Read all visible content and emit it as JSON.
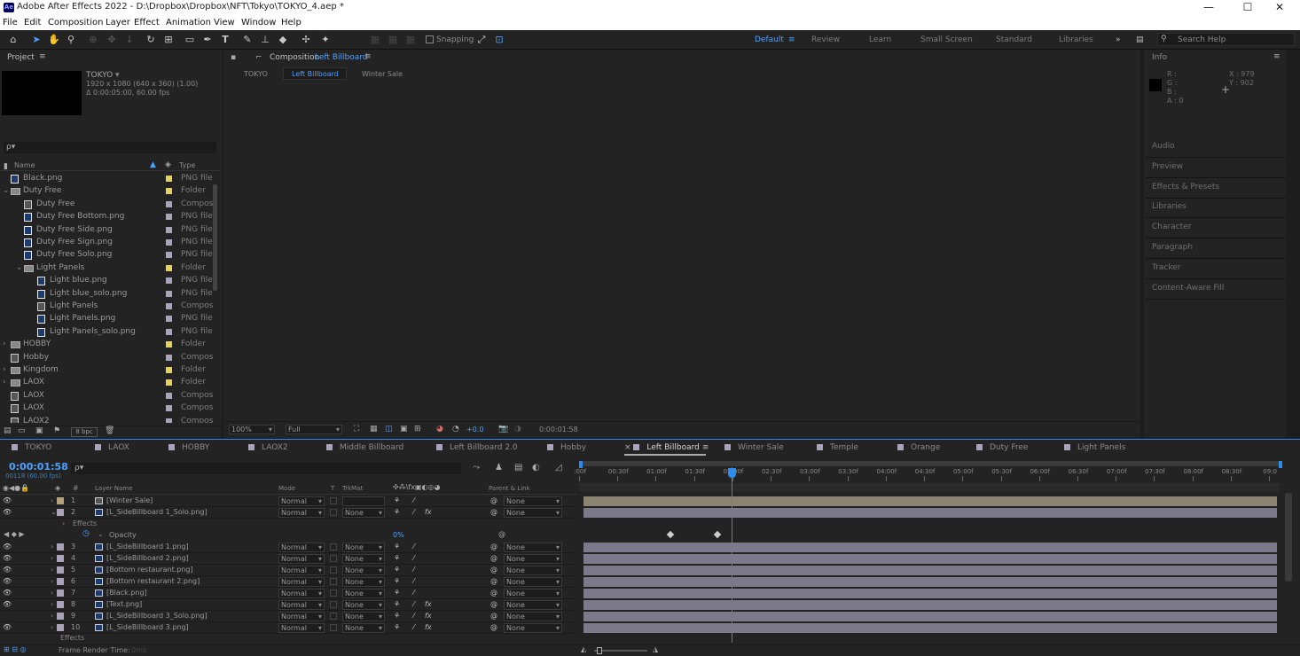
{
  "titlebar": {
    "app_icon": "Ae",
    "title": "Adobe After Effects 2022 - D:\\Dropbox\\Dropbox\\NFT\\Tokyo\\TOKYO_4.aep *",
    "minimize": "—",
    "maximize": "☐",
    "close": "✕"
  },
  "menu": [
    "File",
    "Edit",
    "Composition",
    "Layer",
    "Effect",
    "Animation",
    "View",
    "Window",
    "Help"
  ],
  "toolbar": {
    "snapping": "Snapping",
    "search_placeholder": "Search Help",
    "workspaces": [
      "Default",
      "Review",
      "Learn",
      "Small Screen",
      "Standard",
      "Libraries"
    ],
    "more": "»"
  },
  "project": {
    "title": "Project",
    "comp_name": "TOKYO",
    "comp_info1": "1920 x 1080  (640 x 360) (1.00)",
    "comp_info2": "Δ 0:00:05:00, 60.00 fps",
    "search_placeholder": "ρ▾",
    "col_name": "Name",
    "col_type": "Type",
    "bpc": "8 bpc",
    "items": [
      {
        "name": "Black.png",
        "type": "PNG file",
        "indent": 0,
        "label": "#e5d25c"
      },
      {
        "name": "Duty Free",
        "type": "Folder",
        "indent": 0,
        "label": "#e5d25c",
        "expanded": true
      },
      {
        "name": "Duty Free",
        "type": "Compos",
        "indent": 1,
        "label": "#a9a4b9"
      },
      {
        "name": "Duty Free Bottom.png",
        "type": "PNG file",
        "indent": 1,
        "label": "#a9a4b9"
      },
      {
        "name": "Duty Free Side.png",
        "type": "PNG file",
        "indent": 1,
        "label": "#a9a4b9"
      },
      {
        "name": "Duty Free Sign.png",
        "type": "PNG file",
        "indent": 1,
        "label": "#a9a4b9"
      },
      {
        "name": "Duty Free Solo.png",
        "type": "PNG file",
        "indent": 1,
        "label": "#a9a4b9"
      },
      {
        "name": "Light Panels",
        "type": "Folder",
        "indent": 1,
        "label": "#e5d25c",
        "expanded": true
      },
      {
        "name": "Light blue.png",
        "type": "PNG file",
        "indent": 2,
        "label": "#a9a4b9"
      },
      {
        "name": "Light blue_solo.png",
        "type": "PNG file",
        "indent": 2,
        "label": "#a9a4b9"
      },
      {
        "name": "Light Panels",
        "type": "Compos",
        "indent": 2,
        "label": "#a9a4b9"
      },
      {
        "name": "Light Panels.png",
        "type": "PNG file",
        "indent": 2,
        "label": "#a9a4b9"
      },
      {
        "name": "Light Panels_solo.png",
        "type": "PNG file",
        "indent": 2,
        "label": "#a9a4b9"
      },
      {
        "name": "HOBBY",
        "type": "Folder",
        "indent": 0,
        "label": "#e5d25c"
      },
      {
        "name": "Hobby",
        "type": "Compos",
        "indent": 0,
        "label": "#a9a4b9"
      },
      {
        "name": "Kingdom",
        "type": "Folder",
        "indent": 0,
        "label": "#e5d25c"
      },
      {
        "name": "LAOX",
        "type": "Folder",
        "indent": 0,
        "label": "#e5d25c"
      },
      {
        "name": "LAOX",
        "type": "Compos",
        "indent": 0,
        "label": "#a9a4b9"
      },
      {
        "name": "LAOX",
        "type": "Compos",
        "indent": 0,
        "label": "#a9a4b9"
      },
      {
        "name": "LAOX2",
        "type": "Compos",
        "indent": 0,
        "label": "#a9a4b9"
      }
    ]
  },
  "composition": {
    "panel_label": "Composition",
    "active_name": "Left Billboard",
    "breadcrumbs": [
      "TOKYO",
      "Left Billboard",
      "Winter Sale"
    ],
    "zoom": "100%",
    "resolution": "Full",
    "exposure": "+0.0",
    "timecode": "0:00:01:58"
  },
  "info": {
    "title": "Info",
    "r": "R :",
    "g": "G :",
    "b": "B :",
    "a": "A : 0",
    "x": "X : 979",
    "y": "Y : 902"
  },
  "side_panels": [
    "Audio",
    "Preview",
    "Effects & Presets",
    "Libraries",
    "Character",
    "Paragraph",
    "Tracker",
    "Content-Aware Fill"
  ],
  "timeline": {
    "tabs": [
      {
        "name": "TOKYO",
        "color": "#a9a4b9"
      },
      {
        "name": "LAOX",
        "color": "#a9a4b9"
      },
      {
        "name": "HOBBY",
        "color": "#a9a4b9"
      },
      {
        "name": "LAOX2",
        "color": "#a9a4b9"
      },
      {
        "name": "Middle Billboard",
        "color": "#a9a4b9"
      },
      {
        "name": "Left Billboard 2.0",
        "color": "#a9a4b9"
      },
      {
        "name": "Hobby",
        "color": "#a9a4b9"
      },
      {
        "name": "Left Billboard",
        "color": "#a9a4b9",
        "active": true
      },
      {
        "name": "Winter Sale",
        "color": "#a9a4b9"
      },
      {
        "name": "Temple",
        "color": "#a9a4b9"
      },
      {
        "name": "Orange",
        "color": "#a9a4b9"
      },
      {
        "name": "Duty Free",
        "color": "#a9a4b9"
      },
      {
        "name": "Light Panels",
        "color": "#a9a4b9"
      }
    ],
    "current_time": "0:00:01:58",
    "frame_info": "00118 (60.00 fps)",
    "search_placeholder": "ρ▾",
    "headers": {
      "layer_name": "Layer Name",
      "mode": "Mode",
      "t": "T",
      "trkmat": "TrkMat",
      "parent": "Parent & Link"
    },
    "ruler": [
      ":00f",
      "00:30f",
      "01:00f",
      "01:30f",
      "02:00f",
      "02:30f",
      "03:00f",
      "03:30f",
      "04:00f",
      "04:30f",
      "05:00f",
      "05:30f",
      "06:00f",
      "06:30f",
      "07:00f",
      "07:30f",
      "08:00f",
      "08:30f",
      "09:0"
    ],
    "playhead_fraction": 0.218,
    "layers": [
      {
        "num": "1",
        "name": "[Winter Sale]",
        "mode": "Normal",
        "trkmat": "",
        "parent": "None",
        "label": "#b4a27c",
        "fx": false,
        "bar": "#8b8470"
      },
      {
        "num": "2",
        "name": "[L_SideBillboard 1_Solo.png]",
        "mode": "Normal",
        "trkmat": "None",
        "parent": "None",
        "label": "#a9a4b9",
        "fx": true,
        "bar": "#7c7a8a",
        "expanded": true
      },
      {
        "num": "3",
        "name": "[L_SideBillboard 1.png]",
        "mode": "Normal",
        "trkmat": "None",
        "parent": "None",
        "label": "#a9a4b9",
        "fx": false,
        "bar": "#7c7a8a"
      },
      {
        "num": "4",
        "name": "[L_SideBillboard 2.png]",
        "mode": "Normal",
        "trkmat": "None",
        "parent": "None",
        "label": "#a9a4b9",
        "fx": false,
        "bar": "#7c7a8a"
      },
      {
        "num": "5",
        "name": "[Bottom restaurant.png]",
        "mode": "Normal",
        "trkmat": "None",
        "parent": "None",
        "label": "#a9a4b9",
        "fx": false,
        "bar": "#7c7a8a"
      },
      {
        "num": "6",
        "name": "[Bottom restaurant 2.png]",
        "mode": "Normal",
        "trkmat": "None",
        "parent": "None",
        "label": "#a9a4b9",
        "fx": false,
        "bar": "#7c7a8a"
      },
      {
        "num": "7",
        "name": "[Black.png]",
        "mode": "Normal",
        "trkmat": "None",
        "parent": "None",
        "label": "#a9a4b9",
        "fx": false,
        "bar": "#7c7a8a"
      },
      {
        "num": "8",
        "name": "[Text.png]",
        "mode": "Normal",
        "trkmat": "None",
        "parent": "None",
        "label": "#a9a4b9",
        "fx": true,
        "bar": "#7c7a8a"
      },
      {
        "num": "9",
        "name": "[L_SideBillboard 3_Solo.png]",
        "mode": "Normal",
        "trkmat": "None",
        "parent": "None",
        "label": "#a9a4b9",
        "fx": true,
        "bar": "#7c7a8a"
      },
      {
        "num": "10",
        "name": "[L_SideBillboard 3.png]",
        "mode": "Normal",
        "trkmat": "None",
        "parent": "None",
        "label": "#a9a4b9",
        "fx": true,
        "bar": "#7c7a8a"
      }
    ],
    "effects_label": "Effects",
    "opacity_label": "Opacity",
    "opacity_value": "0%",
    "keyframes": [
      0.13,
      0.197
    ],
    "bottom_status": "Frame Render Time:",
    "render_time": "0ms"
  },
  "colors": {
    "accent": "#2d8ceb",
    "bg": "#1d1d1d",
    "panel": "#232323"
  }
}
